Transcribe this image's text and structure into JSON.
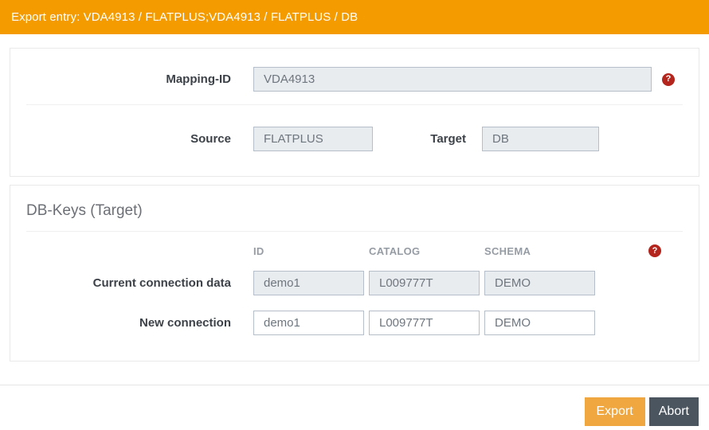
{
  "titlebar": {
    "title": "Export entry: VDA4913 / FLATPLUS;VDA4913 / FLATPLUS / DB"
  },
  "mapping_panel": {
    "mapping_id_label": "Mapping-ID",
    "mapping_id_value": "VDA4913",
    "source_label": "Source",
    "source_value": "FLATPLUS",
    "target_label": "Target",
    "target_value": "DB"
  },
  "db_keys_panel": {
    "title": "DB-Keys (Target)",
    "columns": {
      "id": "ID",
      "catalog": "CATALOG",
      "schema": "SCHEMA"
    },
    "current_row": {
      "label": "Current connection data",
      "id": "demo1",
      "catalog": "L009777T",
      "schema": "DEMO"
    },
    "new_row": {
      "label": "New connection",
      "id": "demo1",
      "catalog": "L009777T",
      "schema": "DEMO"
    }
  },
  "footer": {
    "export_label": "Export",
    "abort_label": "Abort"
  },
  "icons": {
    "help_glyph": "?"
  },
  "colors": {
    "titlebar_bg": "#f49b00",
    "export_button": "#f0a73f",
    "abort_button": "#4a5560",
    "help_icon_red": "#b3251d",
    "readonly_input_bg": "#e9ecef"
  }
}
